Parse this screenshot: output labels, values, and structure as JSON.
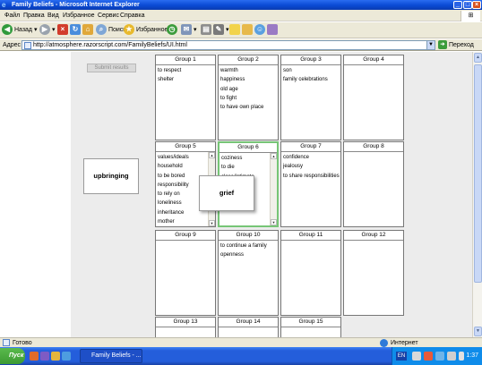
{
  "window": {
    "title": "Family Beliefs - Microsoft Internet Explorer"
  },
  "menu": [
    "Файл",
    "Правка",
    "Вид",
    "Избранное",
    "Сервис",
    "Справка"
  ],
  "toolbar": {
    "back_label": "Назад",
    "search_label": "Поиск",
    "favorites_label": "Избранное"
  },
  "address": {
    "label": "Адрес",
    "url": "http://atmosphere.razorscript.com/FamilyBeliefs/UI.html",
    "go_label": "Переход"
  },
  "page": {
    "submit_label": "Submit results",
    "upbringing_label": "upbringing",
    "dragging_label": "grief",
    "groups": [
      {
        "name": "Group 1",
        "items": [
          "to respect",
          "shelter"
        ]
      },
      {
        "name": "Group 2",
        "items": [
          "warmth",
          "happiness",
          "old age",
          "to fight",
          "to have own place"
        ]
      },
      {
        "name": "Group 3",
        "items": [
          "son",
          "family celebrations"
        ]
      },
      {
        "name": "Group 4",
        "items": []
      },
      {
        "name": "Group 5",
        "items": [
          "values/ideals",
          "household",
          "to be bored",
          "responsibility",
          "to rely on",
          "loneliness",
          "inheritance",
          "mother"
        ]
      },
      {
        "name": "Group 6",
        "items": [
          "coziness",
          "to die",
          "close/intimate",
          "",
          "",
          "",
          "agreement",
          "affection"
        ]
      },
      {
        "name": "Group 7",
        "items": [
          "confidence",
          "jealousy",
          "to share responsibilities"
        ]
      },
      {
        "name": "Group 8",
        "items": []
      },
      {
        "name": "Group 9",
        "items": []
      },
      {
        "name": "Group 10",
        "items": [
          "to continue a family",
          "openness"
        ]
      },
      {
        "name": "Group 11",
        "items": []
      },
      {
        "name": "Group 12",
        "items": []
      },
      {
        "name": "Group 13",
        "items": []
      },
      {
        "name": "Group 14",
        "items": []
      },
      {
        "name": "Group 15",
        "items": []
      }
    ]
  },
  "statusbar": {
    "left_text": "Готово",
    "zone_text": "Интернет"
  },
  "taskbar": {
    "start_label": "Пуск",
    "task_label": "Family Beliefs - ...",
    "lang": "EN",
    "clock": "1:37"
  }
}
